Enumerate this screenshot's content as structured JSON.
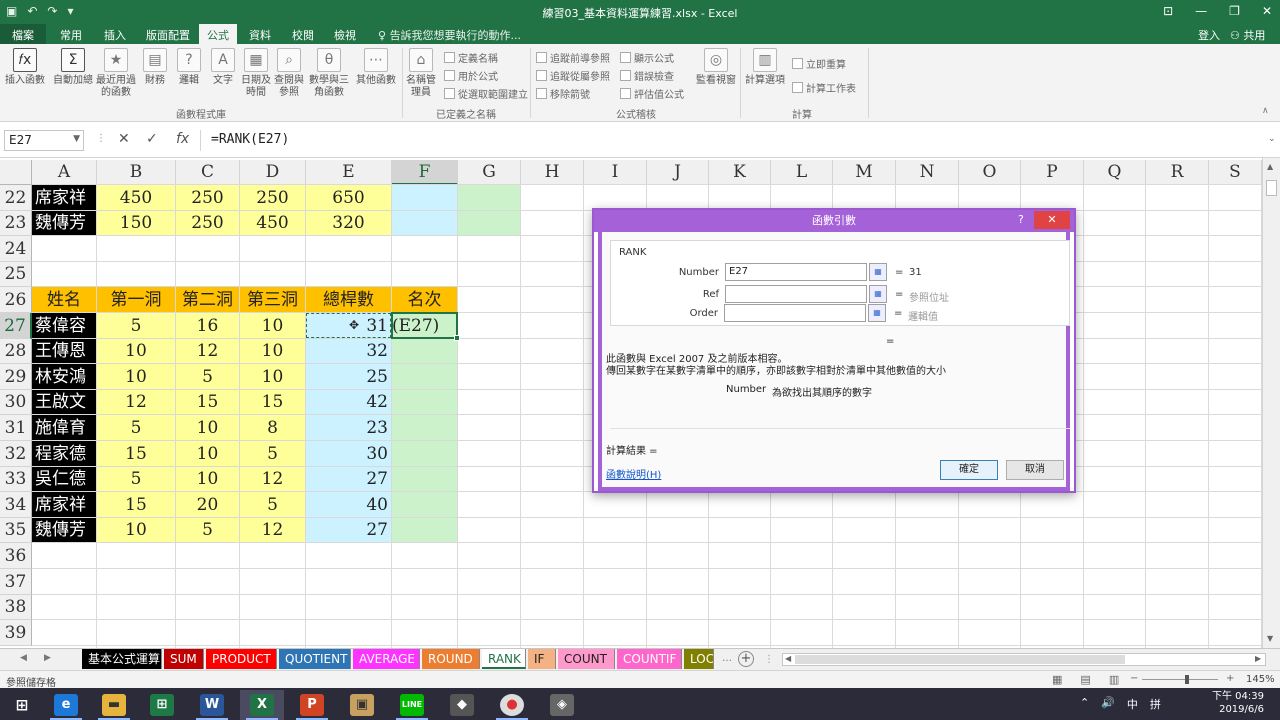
{
  "window": {
    "title": "練習03_基本資料運算練習.xlsx - Excel",
    "file_tab": "檔案",
    "tabs": [
      "常用",
      "插入",
      "版面配置",
      "公式",
      "資料",
      "校閱",
      "檢視"
    ],
    "active_tab": "公式",
    "tell_me": "告訴我您想要執行的動作...",
    "sign_in": "登入",
    "share": "共用"
  },
  "ribbon": {
    "big_buttons": [
      {
        "label": "插入函數",
        "icon": "fx-icon"
      },
      {
        "label": "自動加總",
        "icon": "sigma-icon"
      },
      {
        "label": "最近用過的函數",
        "icon": "star-icon"
      },
      {
        "label": "財務",
        "icon": "book-icon"
      },
      {
        "label": "邏輯",
        "icon": "question-icon"
      },
      {
        "label": "文字",
        "icon": "text-icon"
      },
      {
        "label": "日期及時間",
        "icon": "calendar-icon"
      },
      {
        "label": "查閱與參照",
        "icon": "lookup-icon"
      },
      {
        "label": "數學與三角函數",
        "icon": "theta-icon"
      },
      {
        "label": "其他函數",
        "icon": "more-icon"
      },
      {
        "label": "名稱管理員",
        "icon": "tag-icon"
      },
      {
        "label": "監看視窗",
        "icon": "watch-icon"
      },
      {
        "label": "計算選項",
        "icon": "calc-icon"
      }
    ],
    "names_small": [
      "定義名稱",
      "用於公式",
      "從選取範圍建立"
    ],
    "audit_small": [
      "追蹤前導參照",
      "顯示公式",
      "追蹤從屬參照",
      "錯誤檢查",
      "移除箭號",
      "評估值公式"
    ],
    "calc_small": [
      "立即重算",
      "計算工作表"
    ],
    "groups": [
      "函數程式庫",
      "已定義之名稱",
      "公式稽核",
      "計算"
    ]
  },
  "formula_bar": {
    "name_box": "E27",
    "formula": "=RANK(E27)"
  },
  "grid": {
    "columns": [
      "A",
      "B",
      "C",
      "D",
      "E",
      "F",
      "G",
      "H",
      "I",
      "J",
      "K",
      "L",
      "M",
      "N",
      "O",
      "P",
      "Q",
      "R",
      "S"
    ],
    "rows": [
      "22",
      "23",
      "24",
      "25",
      "26",
      "27",
      "28",
      "29",
      "30",
      "31",
      "32",
      "33",
      "34",
      "35",
      "36",
      "37",
      "38",
      "39"
    ],
    "top_rows": [
      {
        "name": "席家祥",
        "b": "450",
        "c": "250",
        "d": "250",
        "e": "650"
      },
      {
        "name": "魏傳芳",
        "b": "150",
        "c": "250",
        "d": "450",
        "e": "320"
      }
    ],
    "headers": [
      "姓名",
      "第一洞",
      "第二洞",
      "第三洞",
      "總桿數",
      "名次"
    ],
    "data_rows": [
      {
        "name": "蔡偉容",
        "b": "5",
        "c": "16",
        "d": "10",
        "e": "31",
        "f": "(E27)"
      },
      {
        "name": "王傳恩",
        "b": "10",
        "c": "12",
        "d": "10",
        "e": "32",
        "f": ""
      },
      {
        "name": "林安鴻",
        "b": "10",
        "c": "5",
        "d": "10",
        "e": "25",
        "f": ""
      },
      {
        "name": "王啟文",
        "b": "12",
        "c": "15",
        "d": "15",
        "e": "42",
        "f": ""
      },
      {
        "name": "施偉育",
        "b": "5",
        "c": "10",
        "d": "8",
        "e": "23",
        "f": ""
      },
      {
        "name": "程家德",
        "b": "15",
        "c": "10",
        "d": "5",
        "e": "30",
        "f": ""
      },
      {
        "name": "吳仁德",
        "b": "5",
        "c": "10",
        "d": "12",
        "e": "27",
        "f": ""
      },
      {
        "name": "席家祥",
        "b": "15",
        "c": "20",
        "d": "5",
        "e": "40",
        "f": ""
      },
      {
        "name": "魏傳芳",
        "b": "10",
        "c": "5",
        "d": "12",
        "e": "27",
        "f": ""
      }
    ]
  },
  "sheet_tabs": [
    {
      "label": "基本公式運算",
      "bg": "#000000",
      "fg": "#ffffff"
    },
    {
      "label": "SUM",
      "bg": "#c00000",
      "fg": "#ffffff"
    },
    {
      "label": "PRODUCT",
      "bg": "#ff0000",
      "fg": "#ffffff"
    },
    {
      "label": "QUOTIENT",
      "bg": "#2e75b6",
      "fg": "#ffffff"
    },
    {
      "label": "AVERAGE",
      "bg": "#ff33ff",
      "fg": "#ffffff"
    },
    {
      "label": "ROUND",
      "bg": "#ed7d31",
      "fg": "#ffffff"
    },
    {
      "label": "RANK",
      "bg": "#ffffff",
      "fg": "#217346"
    },
    {
      "label": "IF",
      "bg": "#f4b183",
      "fg": "#222222"
    },
    {
      "label": "COUNT",
      "bg": "#ff99cc",
      "fg": "#222222"
    },
    {
      "label": "COUNTIF",
      "bg": "#ff66cc",
      "fg": "#ffffff"
    },
    {
      "label": "LOC",
      "bg": "#808000",
      "fg": "#ffffff"
    }
  ],
  "status": {
    "mode": "參照儲存格",
    "zoom": "145%",
    "zoom_fraction": 0.6
  },
  "taskbar": {
    "apps": [
      "windows-icon",
      "edge-icon",
      "explorer-icon",
      "store-icon",
      "word-icon",
      "excel-icon",
      "powerpoint-icon",
      "photos-icon",
      "line-icon",
      "game-icon",
      "chrome-icon",
      "app-icon"
    ],
    "tray": [
      "⌃",
      "🔊",
      "中",
      "拼"
    ],
    "time": "下午 04:39",
    "date": "2019/6/6"
  },
  "dialog": {
    "title": "函數引數",
    "help": "?",
    "close": "✕",
    "function_name": "RANK",
    "args": [
      {
        "label": "Number",
        "value": "E27",
        "result": "31"
      },
      {
        "label": "Ref",
        "value": "",
        "result": "參照位址"
      },
      {
        "label": "Order",
        "value": "",
        "result": "邏輯值"
      }
    ],
    "equals": "=",
    "desc_line1": "此函數與 Excel 2007 及之前版本相容。",
    "desc_line2": "傳回某數字在某數字清單中的順序，亦即該數字相對於清單中其他數值的大小",
    "arg_help_name": "Number",
    "arg_help_text": "為欲找出其順序的數字",
    "result_label": "計算結果 =",
    "help_link": "函數說明(H)",
    "ok": "確定",
    "cancel": "取消"
  }
}
